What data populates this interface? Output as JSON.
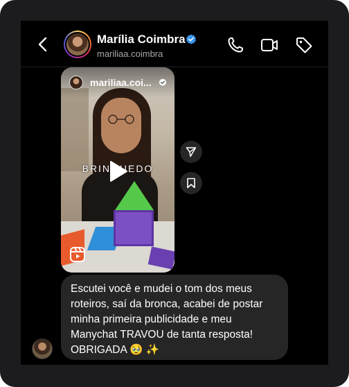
{
  "header": {
    "name": "Marília Coimbra",
    "handle": "mariliaa.coimbra",
    "verified": true,
    "icons": [
      "chevron-left-icon",
      "phone-icon",
      "video-camera-icon",
      "tag-icon"
    ]
  },
  "reel": {
    "username": "mariliaa.coi...",
    "verified": true,
    "overlay_text": "BRINQUEDO",
    "icons": [
      "play-icon",
      "reels-icon"
    ]
  },
  "actions": {
    "icons": [
      "send-icon",
      "bookmark-icon"
    ]
  },
  "message": {
    "text": "Escutei você e mudei o tom dos meus roteiros, saí da bronca, acabei de postar minha primeira publicidade e meu Manychat TRAVOU de tanta resposta! OBRIGADA 🥹 ✨"
  },
  "colors": {
    "background": "#000000",
    "bubble": "#262626",
    "verified": "#3897f0",
    "text_secondary": "#a8a8a8"
  }
}
